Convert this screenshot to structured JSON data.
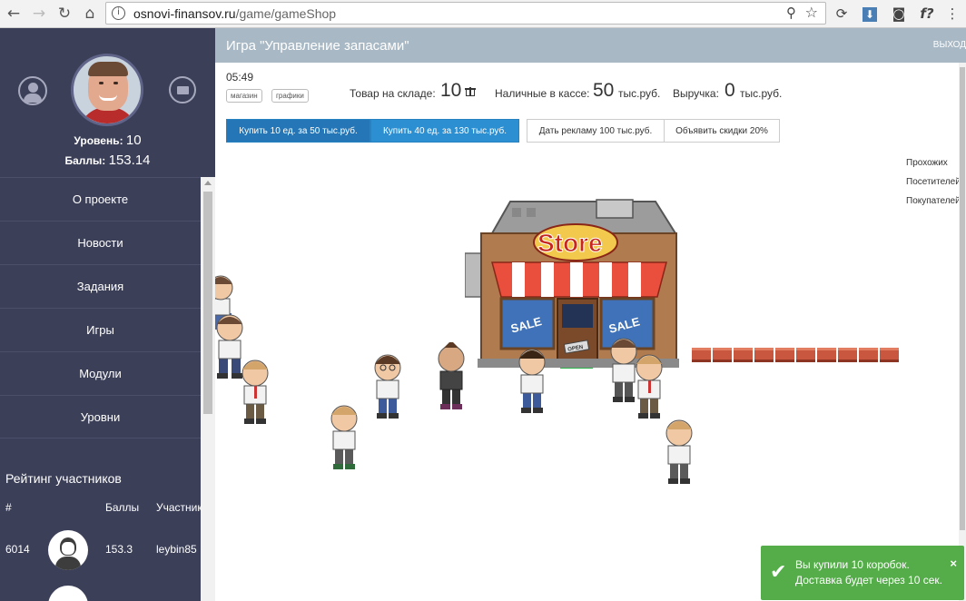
{
  "browser": {
    "url_host": "osnovi-finansov.ru",
    "url_path": "/game/gameShop"
  },
  "sidebar": {
    "level_label": "Уровень:",
    "level_value": "10",
    "score_label": "Баллы:",
    "score_value": "153.14",
    "menu": [
      {
        "label": "О проекте"
      },
      {
        "label": "Новости"
      },
      {
        "label": "Задания"
      },
      {
        "label": "Игры"
      },
      {
        "label": "Модули"
      },
      {
        "label": "Уровни"
      }
    ],
    "rating": {
      "title": "Рейтинг участников",
      "col_num": "#",
      "col_score": "Баллы",
      "col_user": "Участник",
      "rows": [
        {
          "num": "6014",
          "score": "153.3",
          "user": "leybin85"
        }
      ]
    }
  },
  "game": {
    "title": "Игра \"Управление запасами\"",
    "exit_label": "ВЫХОД",
    "timer": "05:49",
    "tags": [
      "магазин",
      "графики"
    ],
    "stock_label": "Товар на складе:",
    "stock_value": "10",
    "cash_label": "Наличные в кассе:",
    "cash_value": "50",
    "cash_unit": "тыс.руб.",
    "revenue_label": "Выручка:",
    "revenue_value": "0",
    "revenue_unit": "тыс.руб.",
    "buttons": {
      "buy10": "Купить 10 ед. за 50 тыс.руб.",
      "buy40": "Купить 40 ед. за 130 тыс.руб.",
      "ads": "Дать рекламу 100 тыс.руб.",
      "discount": "Объявить скидки 20%"
    },
    "legend": [
      "Прохожих",
      "Посетителей",
      "Покупателей"
    ],
    "store_sign": "Store",
    "sale_label": "SALE",
    "open_label": "OPEN"
  },
  "toast": {
    "line1": "Вы купили 10 коробок.",
    "line2": "Доставка будет через 10 сек.",
    "color": "#55ad4a"
  }
}
